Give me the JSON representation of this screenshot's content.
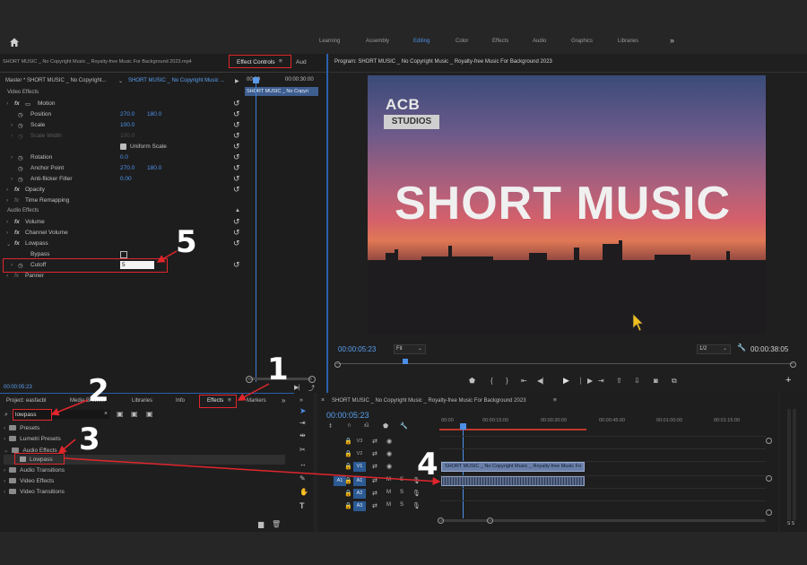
{
  "topbar": {
    "workspaces": [
      "Learning",
      "Assembly",
      "Editing",
      "Color",
      "Effects",
      "Audio",
      "Graphics",
      "Libraries"
    ],
    "active_workspace": "Editing",
    "more": "»"
  },
  "source_panel": {
    "clip_name": "SHORT MUSIC _ No Copyright Music _ Royalty-free Music For Background 2023.mp4",
    "tab_effect_controls": "Effect Controls",
    "tab_menu": "≡",
    "tab_audio": "Aud",
    "master_label": "Master * SHORT MUSIC _ No Copyright...",
    "clip_selector": "SHORT MUSIC _ No Copyright Music ...",
    "ruler_start": "00:00",
    "ruler_end": "00:00:30:00",
    "clip_bar": "SHORT MUSIC _ No Copyri",
    "timecode": "00:00:05:23"
  },
  "effects": {
    "video_header": "Video Effects",
    "motion": "Motion",
    "position": {
      "label": "Position",
      "x": "270.0",
      "y": "180.0"
    },
    "scale": {
      "label": "Scale",
      "value": "100.0"
    },
    "scale_width": {
      "label": "Scale Width",
      "value": "100.0"
    },
    "uniform_scale": "Uniform Scale",
    "rotation": {
      "label": "Rotation",
      "value": "0.0"
    },
    "anchor": {
      "label": "Anchor Point",
      "x": "270.0",
      "y": "180.0"
    },
    "antiflicker": {
      "label": "Anti-flicker Filter",
      "value": "0.00"
    },
    "opacity": "Opacity",
    "time_remap": "Time Remapping",
    "audio_header": "Audio Effects",
    "volume": "Volume",
    "channel_volume": "Channel Volume",
    "lowpass": "Lowpass",
    "bypass": "Bypass",
    "cutoff": {
      "label": "Cutoff",
      "value": "5"
    },
    "panner": "Panner"
  },
  "program": {
    "title": "Program: SHORT MUSIC _ No Copyright Music _ Royalty-free Music For Background 2023",
    "logo_top": "ACB",
    "logo_bottom": "STUDIOS",
    "headline": "SHORT MUSIC",
    "timecode": "00:00:05:23",
    "fit": "Fit",
    "quality": "1/2",
    "duration": "00:00:38:05"
  },
  "project_panel": {
    "tab_project": "Project: easfacbl",
    "tab_media": "Media Browser",
    "tab_libraries": "Libraries",
    "tab_info": "Info",
    "tab_effects": "Effects",
    "tab_menu": "≡",
    "tab_markers": "Markers",
    "more": "»",
    "search_value": "lowpass",
    "clear": "×",
    "tree": [
      "Presets",
      "Lumetri Presets",
      "Audio Effects",
      "Lowpass",
      "Audio Transitions",
      "Video Effects",
      "Video Transitions"
    ]
  },
  "timeline": {
    "sequence_title": "SHORT MUSIC _ No Copyright Music _ Royalty-free Music For Background 2023",
    "timecode": "00:00:05:23",
    "ruler": [
      "00:00",
      "00:00:15:00",
      "00:00:30:00",
      "00:00:45:00",
      "00:01:00:00",
      "00:01:15:00"
    ],
    "video_tracks": [
      "V3",
      "V2",
      "V1"
    ],
    "audio_tracks": [
      "A1",
      "A2",
      "A3"
    ],
    "m": "M",
    "s": "S",
    "video_clip": "SHORT MUSIC _ No Copyright Music _ Royalty-free Music Fo",
    "meter_labels": "S S"
  },
  "annotations": [
    "1",
    "2",
    "3",
    "4",
    "5"
  ],
  "colors": {
    "accent": "#4d8fe6",
    "annotation": "#e0262c"
  }
}
